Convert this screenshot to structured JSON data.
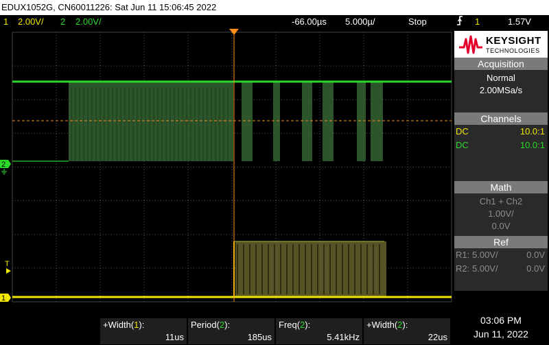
{
  "title_bar": {
    "text": "EDUX1052G, CN60011226: Sat Jun 11 15:06:45 2022"
  },
  "status": {
    "ch1_num": "1",
    "ch1_scale": "2.00V/",
    "ch2_num": "2",
    "ch2_scale": "2.00V/",
    "time_offset": "-66.00µs",
    "time_scale": "5.000µ/",
    "run_state": "Stop",
    "trigger_icon": "trigger-edge-icon",
    "trigger_source": "1",
    "trigger_level": "1.57V"
  },
  "markers": {
    "ch2_marker": "2",
    "ch1_marker": "1",
    "trigger_marker": "T"
  },
  "logo": {
    "name": "KEYSIGHT",
    "sub": "TECHNOLOGIES",
    "icon": "keysight-wave-icon"
  },
  "acquisition": {
    "title": "Acquisition",
    "mode": "Normal",
    "rate": "2.00MSa/s"
  },
  "channels": {
    "title": "Channels",
    "rows": [
      {
        "coupling": "DC",
        "probe": "10.0:1"
      },
      {
        "coupling": "DC",
        "probe": "10.0:1"
      }
    ]
  },
  "math": {
    "title": "Math",
    "function": "Ch1 + Ch2",
    "scale": "1.00V/",
    "offset": "0.0V"
  },
  "ref": {
    "title": "Ref",
    "rows": [
      {
        "name": "R1:",
        "scale": "5.00V/",
        "offset": "0.0V"
      },
      {
        "name": "R2:",
        "scale": "5.00V/",
        "offset": "0.0V"
      }
    ]
  },
  "measurements": [
    {
      "label_prefix": "+Width(",
      "channel": "1",
      "label_suffix": "):",
      "value": "11us"
    },
    {
      "label_prefix": "Period(",
      "channel": "2",
      "label_suffix": "):",
      "value": "185us"
    },
    {
      "label_prefix": "Freq(",
      "channel": "2",
      "label_suffix": "):",
      "value": "5.41kHz"
    },
    {
      "label_prefix": "+Width(",
      "channel": "2",
      "label_suffix": "):",
      "value": "22us"
    }
  ],
  "clock": {
    "time": "03:06 PM",
    "date": "Jun 11, 2022"
  },
  "colors": {
    "ch1": "#f2e600",
    "ch2": "#2bd92b",
    "grid": "#5a5a5a",
    "trigger": "#ff8c1a"
  }
}
